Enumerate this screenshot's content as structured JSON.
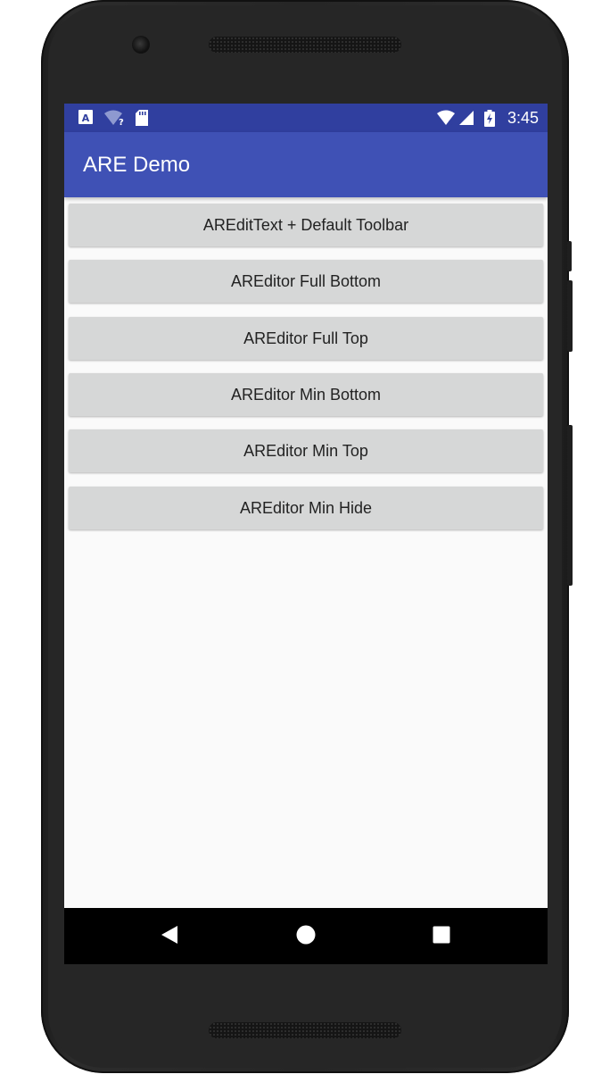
{
  "status_bar": {
    "time": "3:45",
    "left_icons": [
      "a-notification-icon",
      "wifi-question-icon",
      "sd-card-icon"
    ],
    "right_icons": [
      "wifi-off-icon",
      "cell-signal-icon",
      "battery-charging-icon"
    ],
    "color": "#303f9f"
  },
  "app_bar": {
    "title": "ARE Demo",
    "color": "#3f51b5"
  },
  "main": {
    "buttons": [
      {
        "label": "AREditText + Default Toolbar"
      },
      {
        "label": "AREditor Full Bottom"
      },
      {
        "label": "AREditor Full Top"
      },
      {
        "label": "AREditor Min Bottom"
      },
      {
        "label": "AREditor Min Top"
      },
      {
        "label": "AREditor Min Hide"
      }
    ]
  },
  "nav_bar": {
    "items": [
      "back-icon",
      "home-icon",
      "recents-icon"
    ]
  }
}
